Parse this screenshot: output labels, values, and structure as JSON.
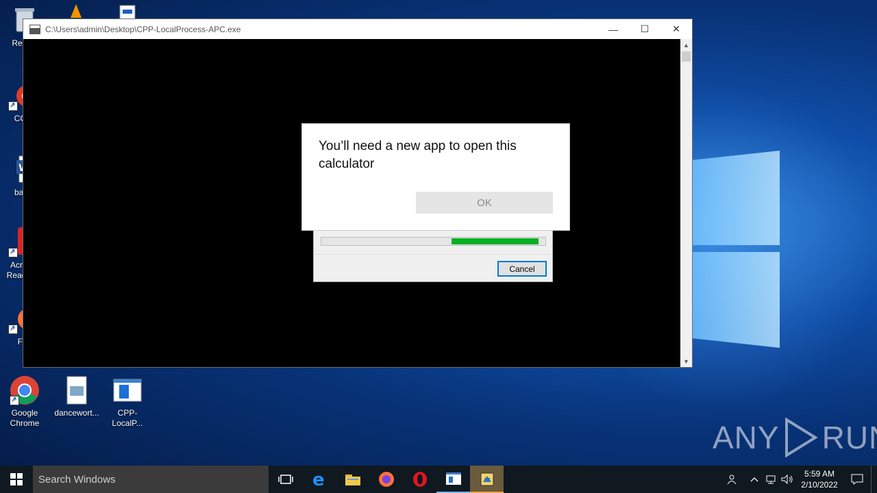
{
  "desktop": {
    "icons": [
      {
        "label": "Recyc"
      },
      {
        "label": "CCle"
      },
      {
        "label": "baby"
      },
      {
        "label": "Acr Read"
      },
      {
        "label": "Firi"
      },
      {
        "label": "Google Chrome"
      },
      {
        "label": "dancewort..."
      },
      {
        "label": "CPP-LocalP..."
      }
    ]
  },
  "window": {
    "title": "C:\\Users\\admin\\Desktop\\CPP-LocalProcess-APC.exe",
    "minimize_glyph": "—",
    "maximize_glyph": "☐",
    "close_glyph": "✕"
  },
  "message_dialog": {
    "text": "You’ll need a new app to open this calculator",
    "ok_label": "OK"
  },
  "progress_dialog": {
    "progress_segment_start": 0.58,
    "progress_segment_end": 0.97,
    "fill_color": "#06b025",
    "cancel_label": "Cancel"
  },
  "watermark": {
    "left": "ANY",
    "right": "RUN"
  },
  "taskbar": {
    "search_placeholder": "Search Windows",
    "apps": [
      "task-view",
      "edge",
      "file-explorer",
      "firefox",
      "opera",
      "cpp-app",
      "active-app"
    ],
    "time": "5:59 AM",
    "date": "2/10/2022"
  }
}
